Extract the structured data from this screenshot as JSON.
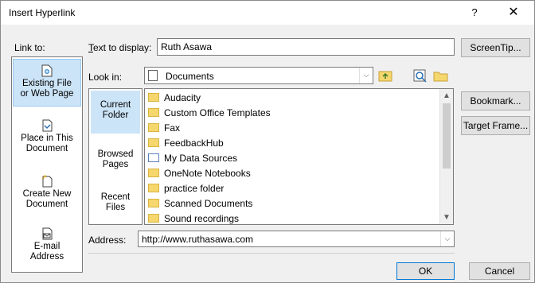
{
  "window": {
    "title": "Insert Hyperlink",
    "help_label": "?",
    "close_label": "✕"
  },
  "link_to": {
    "label": "Link to:",
    "items": [
      {
        "label_line1": "Existing File",
        "label_line2": "or Web Page",
        "icon": "existing-file-icon",
        "selected": true
      },
      {
        "label_line1": "Place in This",
        "label_line2": "Document",
        "icon": "place-in-document-icon",
        "selected": false
      },
      {
        "label_line1": "Create New",
        "label_line2": "Document",
        "icon": "create-new-document-icon",
        "selected": false
      },
      {
        "label_line1": "E-mail",
        "label_line2": "Address",
        "icon": "email-address-icon",
        "selected": false
      }
    ]
  },
  "text_to_display": {
    "label": "Text to display:",
    "value": "Ruth Asawa"
  },
  "look_in": {
    "label": "Look in:",
    "value": "Documents",
    "icon": "documents-folder-icon"
  },
  "nav": {
    "items": [
      {
        "label_line1": "Current",
        "label_line2": "Folder"
      },
      {
        "label_line1": "Browsed",
        "label_line2": "Pages"
      },
      {
        "label_line1": "Recent",
        "label_line2": "Files"
      }
    ]
  },
  "files": [
    {
      "name": "Audacity",
      "icon": "folder-icon"
    },
    {
      "name": "Custom Office Templates",
      "icon": "folder-icon"
    },
    {
      "name": "Fax",
      "icon": "folder-icon"
    },
    {
      "name": "FeedbackHub",
      "icon": "folder-icon"
    },
    {
      "name": "My Data Sources",
      "icon": "data-sources-folder-icon"
    },
    {
      "name": "OneNote Notebooks",
      "icon": "folder-icon"
    },
    {
      "name": "practice folder",
      "icon": "folder-icon"
    },
    {
      "name": "Scanned Documents",
      "icon": "folder-icon"
    },
    {
      "name": "Sound recordings",
      "icon": "folder-icon"
    }
  ],
  "address": {
    "label": "Address:",
    "value": "http://www.ruthasawa.com"
  },
  "buttons": {
    "screentip": "ScreenTip...",
    "bookmark": "Bookmark...",
    "target_frame": "Target Frame...",
    "ok": "OK",
    "cancel": "Cancel"
  },
  "colors": {
    "selection": "#cce4f7",
    "folder": "#f5d76e",
    "dialog_bg": "#f0f0f0"
  }
}
